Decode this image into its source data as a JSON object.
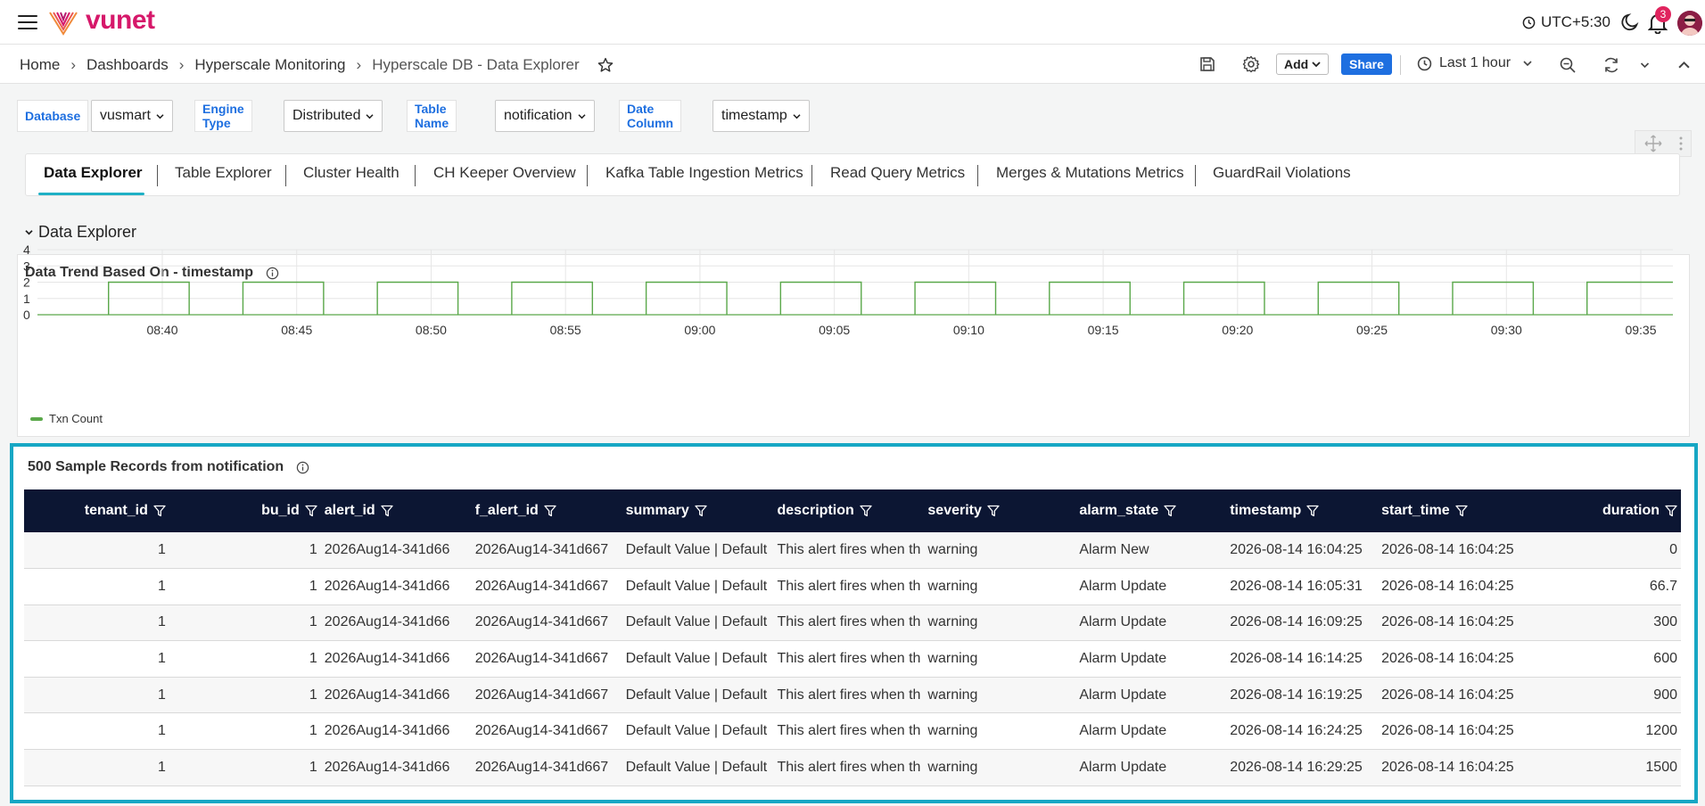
{
  "app": {
    "brand": "vunet",
    "timezone": "UTC+5:30",
    "notification_count": "3"
  },
  "breadcrumb": [
    "Home",
    "Dashboards",
    "Hyperscale Monitoring",
    "Hyperscale DB - Data Explorer"
  ],
  "toolbar": {
    "add_label": "Add",
    "share_label": "Share",
    "time_range": "Last 1 hour"
  },
  "filters": [
    {
      "label": "Database",
      "value": "vusmart"
    },
    {
      "label": "Engine Type",
      "value": "Distributed"
    },
    {
      "label": "Table Name",
      "value": "notification"
    },
    {
      "label": "Date Column",
      "value": "timestamp"
    }
  ],
  "tabs": [
    "Data Explorer",
    "Table Explorer",
    "Cluster Health",
    "CH Keeper Overview",
    "Kafka Table Ingestion Metrics",
    "Read Query Metrics",
    "Merges & Mutations Metrics",
    "GuardRail Violations"
  ],
  "section_title": "Data Explorer",
  "chart_card": {
    "title": "Data Trend Based On - timestamp"
  },
  "chart_data": {
    "type": "line",
    "title": "Data Trend Based On - timestamp",
    "xlabel": "",
    "ylabel": "",
    "ylim": [
      0,
      4
    ],
    "yticks": [
      "0",
      "1",
      "2",
      "3",
      "4"
    ],
    "xticks": [
      "08:40",
      "08:45",
      "08:50",
      "08:55",
      "09:00",
      "09:05",
      "09:10",
      "09:15",
      "09:20",
      "09:25",
      "09:30",
      "09:35"
    ],
    "series": [
      {
        "name": "Txn Count",
        "color": "#5aa84a",
        "step_segments": [
          {
            "from": "08:38",
            "to": "08:41",
            "value": 2
          },
          {
            "from": "08:43",
            "to": "08:46",
            "value": 2
          },
          {
            "from": "08:48",
            "to": "08:51",
            "value": 2
          },
          {
            "from": "08:53",
            "to": "08:56",
            "value": 2
          },
          {
            "from": "08:58",
            "to": "09:01",
            "value": 2
          },
          {
            "from": "09:03",
            "to": "09:06",
            "value": 2
          },
          {
            "from": "09:08",
            "to": "09:11",
            "value": 2
          },
          {
            "from": "09:13",
            "to": "09:16",
            "value": 2
          },
          {
            "from": "09:18",
            "to": "09:21",
            "value": 2
          },
          {
            "from": "09:23",
            "to": "09:26",
            "value": 2
          },
          {
            "from": "09:28",
            "to": "09:31",
            "value": 2
          },
          {
            "from": "09:33",
            "to": "09:35",
            "value": 2
          }
        ]
      }
    ],
    "legend": "bottom-left",
    "grid": true
  },
  "table": {
    "title": "500 Sample Records from notification",
    "columns": [
      "tenant_id",
      "bu_id",
      "alert_id",
      "f_alert_id",
      "summary",
      "description",
      "severity",
      "alarm_state",
      "timestamp",
      "start_time",
      "duration"
    ],
    "rows": [
      [
        "1",
        "1",
        "2026Aug14-341d66",
        "2026Aug14-341d667",
        "Default Value | Default",
        "This alert fires when th",
        "warning",
        "Alarm New",
        "2026-08-14 16:04:25",
        "2026-08-14 16:04:25",
        "0"
      ],
      [
        "1",
        "1",
        "2026Aug14-341d66",
        "2026Aug14-341d667",
        "Default Value | Default",
        "This alert fires when th",
        "warning",
        "Alarm Update",
        "2026-08-14 16:05:31",
        "2026-08-14 16:04:25",
        "66.7"
      ],
      [
        "1",
        "1",
        "2026Aug14-341d66",
        "2026Aug14-341d667",
        "Default Value | Default",
        "This alert fires when th",
        "warning",
        "Alarm Update",
        "2026-08-14 16:09:25",
        "2026-08-14 16:04:25",
        "300"
      ],
      [
        "1",
        "1",
        "2026Aug14-341d66",
        "2026Aug14-341d667",
        "Default Value | Default",
        "This alert fires when th",
        "warning",
        "Alarm Update",
        "2026-08-14 16:14:25",
        "2026-08-14 16:04:25",
        "600"
      ],
      [
        "1",
        "1",
        "2026Aug14-341d66",
        "2026Aug14-341d667",
        "Default Value | Default",
        "This alert fires when th",
        "warning",
        "Alarm Update",
        "2026-08-14 16:19:25",
        "2026-08-14 16:04:25",
        "900"
      ],
      [
        "1",
        "1",
        "2026Aug14-341d66",
        "2026Aug14-341d667",
        "Default Value | Default",
        "This alert fires when th",
        "warning",
        "Alarm Update",
        "2026-08-14 16:24:25",
        "2026-08-14 16:04:25",
        "1200"
      ],
      [
        "1",
        "1",
        "2026Aug14-341d66",
        "2026Aug14-341d667",
        "Default Value | Default",
        "This alert fires when th",
        "warning",
        "Alarm Update",
        "2026-08-14 16:29:25",
        "2026-08-14 16:04:25",
        "1500"
      ]
    ]
  },
  "colors": {
    "brand": "#d6186a",
    "accent": "#1e6fe0",
    "tab_indicator": "#1fb0c5",
    "table_header": "#0c1633",
    "highlight_frame": "#17a7c4",
    "series": "#5aa84a"
  },
  "icons": [
    "hamburger-icon",
    "vunet-logo-icon",
    "clock-icon",
    "moon-icon",
    "bell-icon",
    "avatar",
    "star-icon",
    "save-icon",
    "gear-icon",
    "chevron-down-icon",
    "zoom-out-icon",
    "refresh-icon",
    "collapse-up-icon",
    "move-icon",
    "more-vertical-icon",
    "info-icon",
    "filter-icon"
  ]
}
